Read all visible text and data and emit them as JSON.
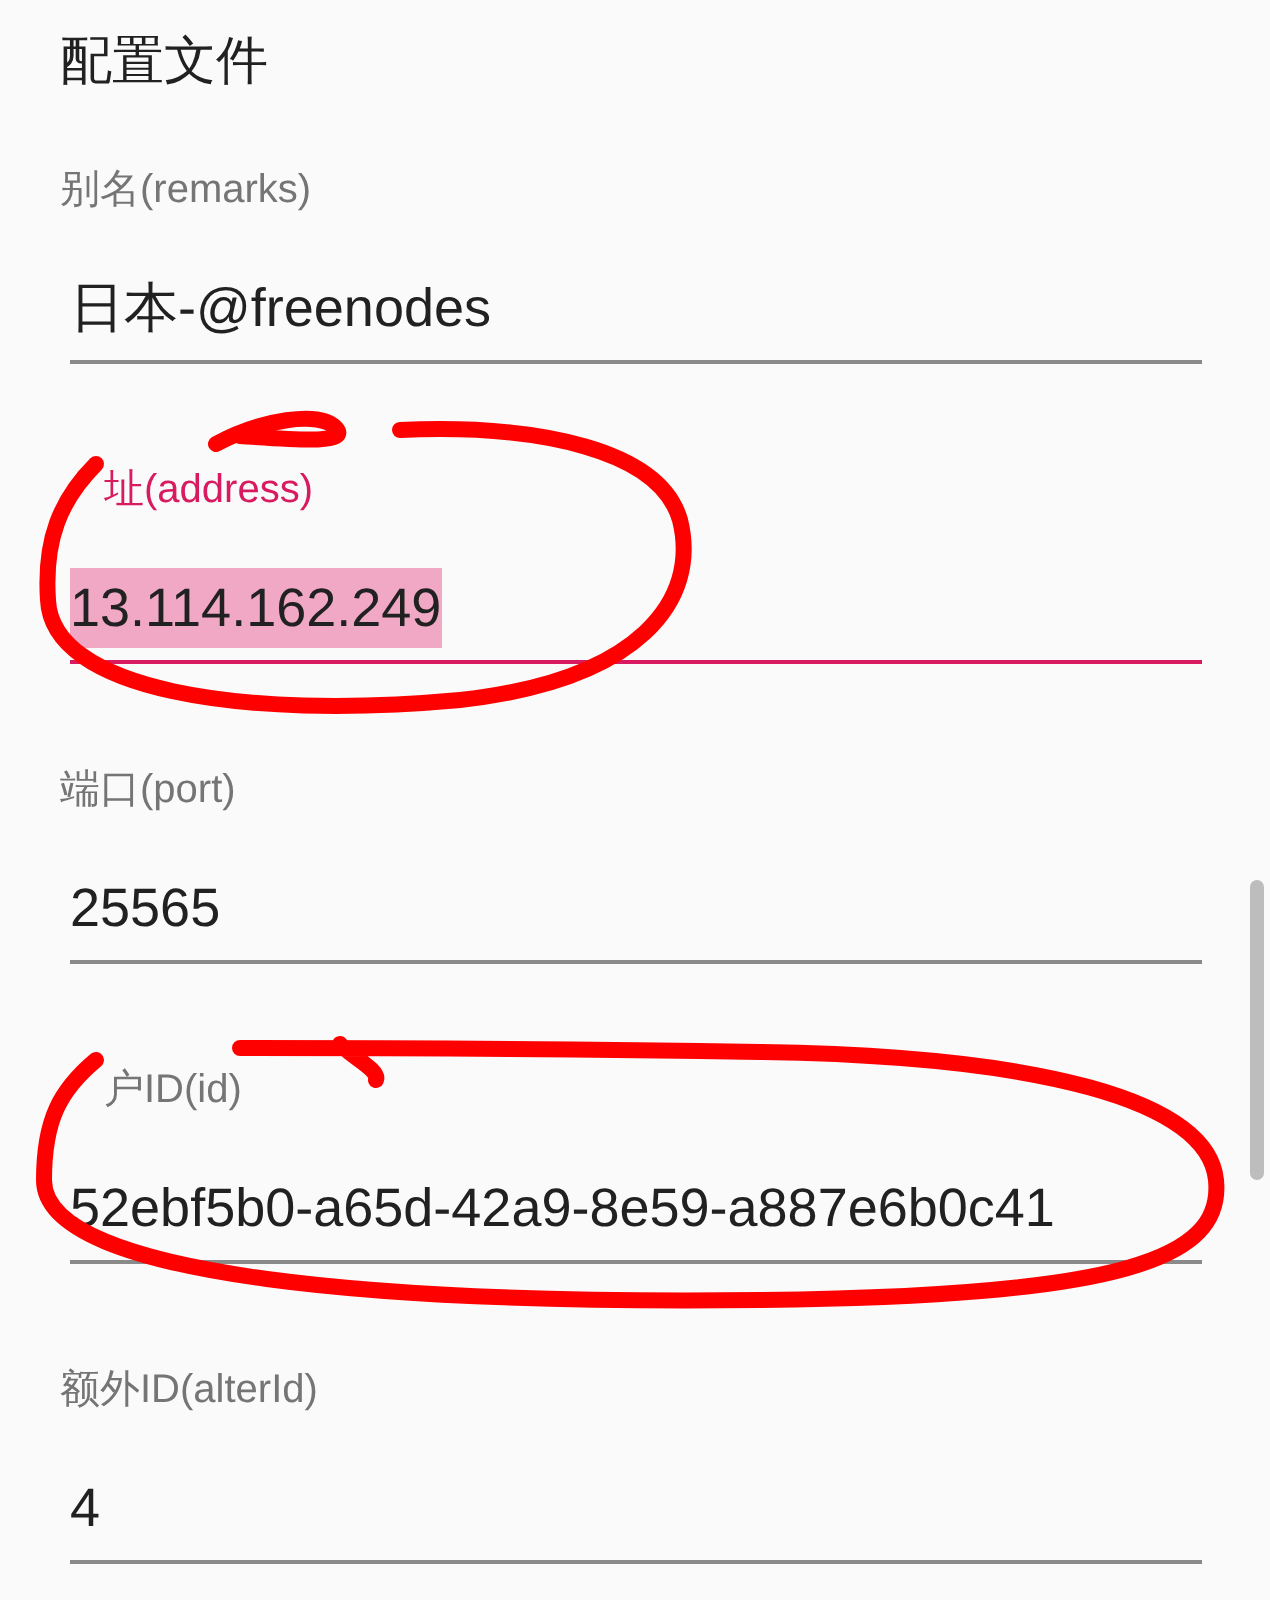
{
  "title": "配置文件",
  "fields": [
    {
      "label": "别名(remarks)",
      "value": "日本-@freenodes",
      "focused": false,
      "text_selected": false
    },
    {
      "label": "址(address)",
      "label_covered": true,
      "value": "13.114.162.249",
      "focused": true,
      "text_selected": true
    },
    {
      "label": "端口(port)",
      "value": "25565",
      "focused": false,
      "text_selected": false
    },
    {
      "label": "户ID(id)",
      "label_covered": true,
      "value": "52ebf5b0-a65d-42a9-8e59-a887e6b0c41",
      "focused": false,
      "text_selected": false
    },
    {
      "label": "额外ID(alterId)",
      "value": "4",
      "focused": false,
      "text_selected": false
    }
  ]
}
